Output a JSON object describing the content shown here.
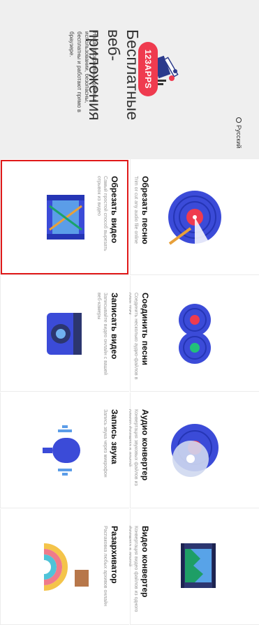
{
  "hero": {
    "language_label": "Русский",
    "logo_text": "123APPS",
    "title": "Бесплатные веб-приложения",
    "description": "Наши программы удобны в использовании, безопасны, бесплатны и работают прямо в браузере."
  },
  "tools": [
    {
      "title": "Обрезать песню",
      "description": "Trim or cut any audio file online",
      "icon": "trim-song-icon"
    },
    {
      "title": "Соединить песни",
      "description": "Соединить несколько аудио-файлов в один трек",
      "icon": "join-songs-icon"
    },
    {
      "title": "Аудио конвертер",
      "description": "Конвертация звуковых файлов из одного формата в другой",
      "icon": "audio-converter-icon"
    },
    {
      "title": "Видео конвертер",
      "description": "Конвертация видео файлов из одного формата в другой",
      "icon": "video-converter-icon"
    },
    {
      "title": "Обрезать видео",
      "description": "Самый простой способ вырезать отрывок из видео",
      "icon": "cut-video-icon",
      "selected": true
    },
    {
      "title": "Записать видео",
      "description": "Записывайте видео онлайн с вашей веб-камеры",
      "icon": "video-recorder-icon"
    },
    {
      "title": "Запись звука",
      "description": "Запись звука через микрофон",
      "icon": "voice-recorder-icon"
    },
    {
      "title": "Разархиватор",
      "description": "Распаковка любых архивов онлайн",
      "icon": "archive-extractor-icon"
    }
  ],
  "colors": {
    "accent_red": "#ef3b4f",
    "selection_outline": "#e01919",
    "hero_bg": "#efefef"
  }
}
